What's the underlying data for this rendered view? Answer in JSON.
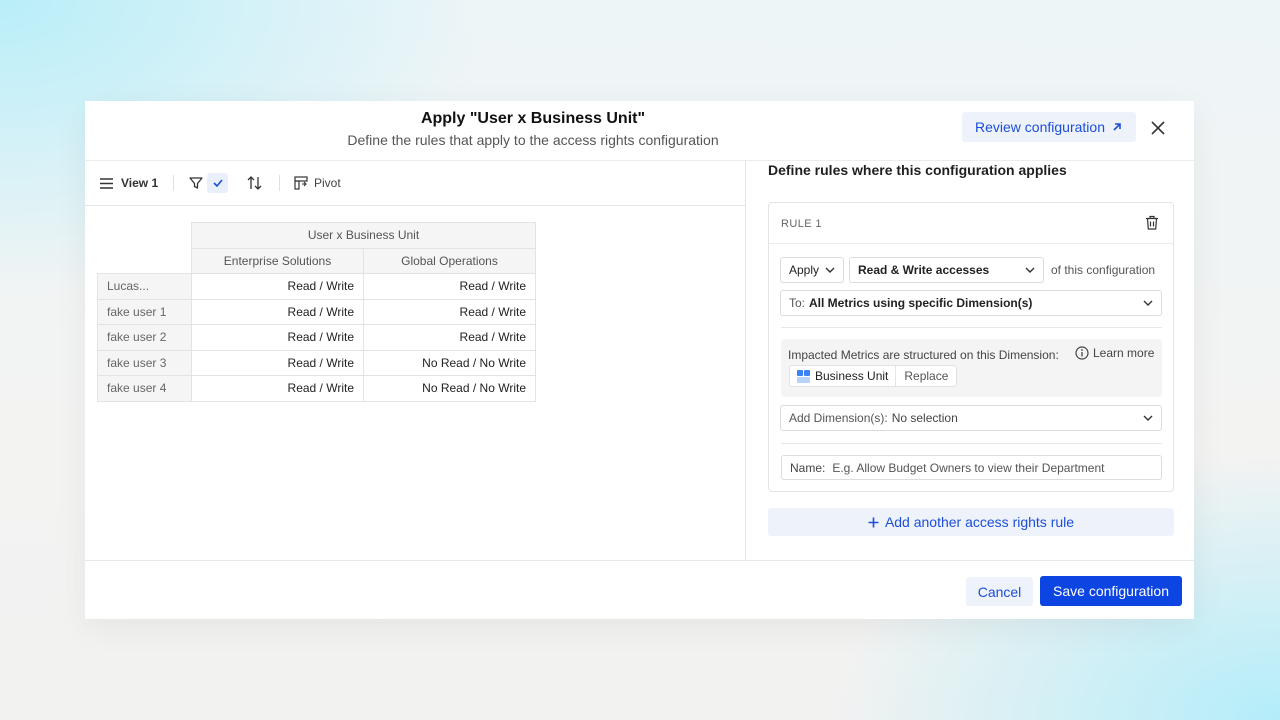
{
  "modal": {
    "title": "Apply \"User x Business Unit\"",
    "subtitle": "Define the rules that apply to the access rights configuration",
    "review_label": "Review configuration",
    "review_icon": "arrow-up-right-icon",
    "close_icon": "close-icon"
  },
  "toolbar": {
    "view_label": "View 1",
    "view_icon": "menu-icon",
    "filter_icon": "filter-icon",
    "check_icon": "check-icon",
    "sort_icon": "sort-icon",
    "pivot_label": "Pivot",
    "pivot_icon": "pivot-icon"
  },
  "table": {
    "group_header": "User x Business Unit",
    "columns": [
      "Enterprise Solutions",
      "Global Operations"
    ],
    "rows": [
      {
        "user": "Lucas...",
        "values": [
          "Read / Write",
          "Read / Write"
        ]
      },
      {
        "user": "fake user 1",
        "values": [
          "Read / Write",
          "Read / Write"
        ]
      },
      {
        "user": "fake user 2",
        "values": [
          "Read / Write",
          "Read / Write"
        ]
      },
      {
        "user": "fake user 3",
        "values": [
          "Read / Write",
          "No Read / No Write"
        ]
      },
      {
        "user": "fake user 4",
        "values": [
          "Read / Write",
          "No Read / No Write"
        ]
      }
    ]
  },
  "rules_panel": {
    "title": "Define rules where this configuration applies",
    "rule": {
      "label": "RULE 1",
      "delete_icon": "trash-icon",
      "apply_value": "Apply",
      "access_value": "Read & Write accesses",
      "of_config_text": "of this configuration",
      "to_label": "To:",
      "to_value": "All Metrics using specific Dimension(s)",
      "impacted_text": "Impacted Metrics are structured on this Dimension:",
      "learn_more": "Learn more",
      "info_icon": "info-icon",
      "dimension_name": "Business Unit",
      "dimension_icon": "dimension-grid-icon",
      "replace_label": "Replace",
      "add_dim_label": "Add Dimension(s):",
      "add_dim_value": "No selection",
      "name_label": "Name:",
      "name_placeholder": "E.g. Allow Budget Owners to view their Department"
    },
    "add_rule_label": "Add another access rights rule"
  },
  "footer": {
    "cancel_label": "Cancel",
    "save_label": "Save configuration"
  },
  "colors": {
    "accent": "#1d4ed8",
    "primary_button": "#0d45e2",
    "soft_button": "#eef2fb"
  }
}
